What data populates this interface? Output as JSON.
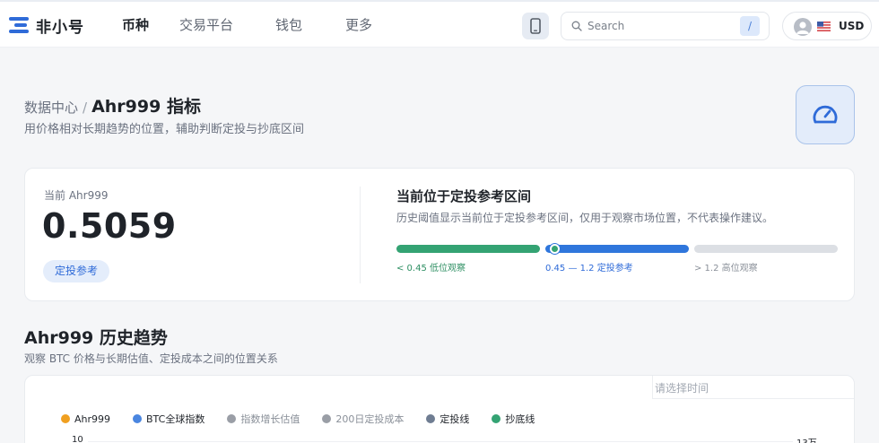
{
  "header": {
    "logo_text": "非小号",
    "nav": [
      "币种",
      "交易平台",
      "钱包",
      "更多"
    ],
    "search_placeholder": "Search",
    "search_shortcut": "/",
    "currency": "USD"
  },
  "page": {
    "breadcrumb_parent": "数据中心",
    "breadcrumb_separator": "/",
    "title": "Ahr999 指标",
    "subtitle": "用价格相对长期趋势的位置，辅助判断定投与抄底区间"
  },
  "summary": {
    "current_label": "当前 Ahr999",
    "current_value": "0.5059",
    "current_tag": "定投参考",
    "zone_title": "当前位于定投参考区间",
    "zone_desc": "历史阈值显示当前位于定投参考区间，仅用于观察市场位置，不代表操作建议。",
    "zones": [
      {
        "label": "< 0.45 低位观察",
        "color": "#34a373"
      },
      {
        "label": "0.45 — 1.2 定投参考",
        "color": "#2f76dc"
      },
      {
        "label": "> 1.2 高位观察",
        "color": "#dcdfe4"
      }
    ]
  },
  "history": {
    "title": "Ahr999 历史趋势",
    "subtitle": "观察 BTC 价格与长期估值、定投成本之间的位置关系",
    "date_placeholder": "请选择时间",
    "legend": [
      {
        "label": "Ahr999",
        "color": "#f0a020"
      },
      {
        "label": "BTC全球指数",
        "color": "#4a86e0"
      },
      {
        "label": "指数增长估值",
        "color": "#9a9ea6"
      },
      {
        "label": "200日定投成本",
        "color": "#9a9ea6"
      },
      {
        "label": "定投线",
        "color": "#6f7d92"
      },
      {
        "label": "抄底线",
        "color": "#34a373"
      }
    ],
    "y_left_top": "10",
    "y_right_top": "13万"
  },
  "colors": {
    "accent": "#2f6bd8",
    "green": "#34a373"
  }
}
